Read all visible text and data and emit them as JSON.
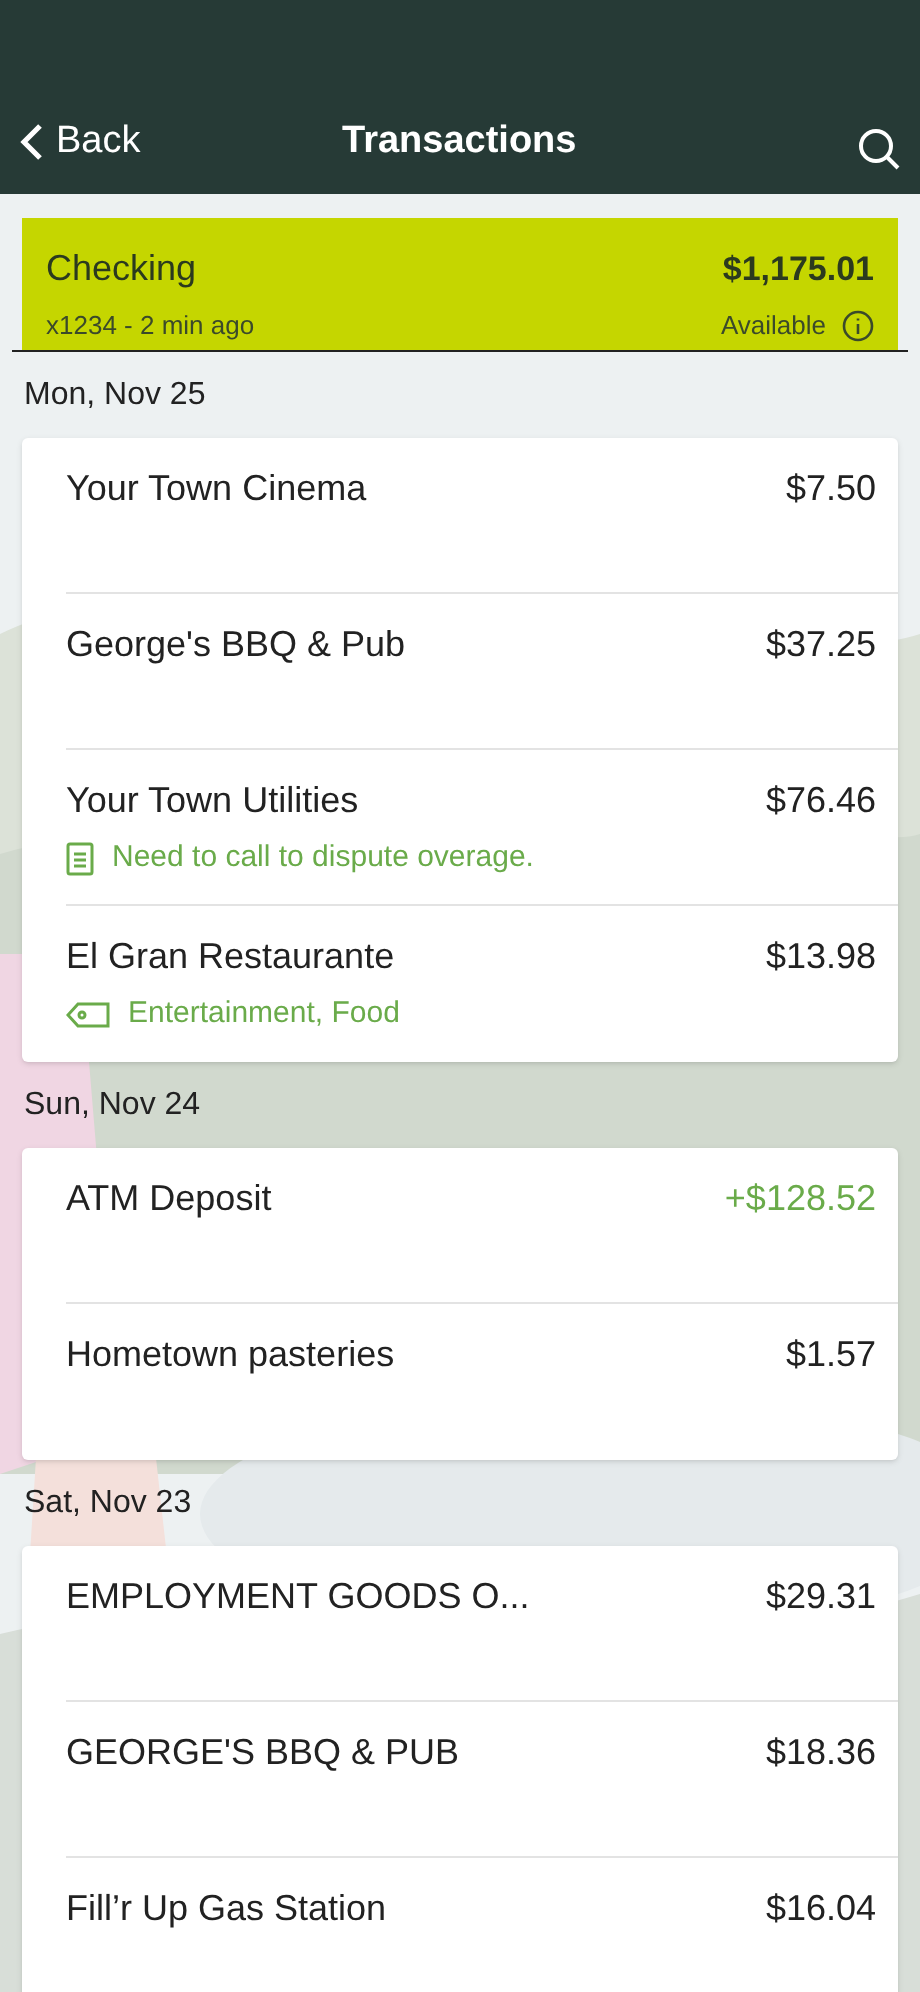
{
  "header": {
    "back": "Back",
    "title": "Transactions"
  },
  "account": {
    "name": "Checking",
    "balance": "$1,175.01",
    "detail": "x1234 - 2 min ago",
    "balance_label": "Available"
  },
  "days": [
    {
      "date": "Mon, Nov 25",
      "transactions": [
        {
          "name": "Your Town Cinema",
          "amount": "$7.50",
          "credit": false
        },
        {
          "name": "George's BBQ & Pub",
          "amount": "$37.25",
          "credit": false
        },
        {
          "name": "Your Town Utilities",
          "amount": "$76.46",
          "credit": false,
          "extra": {
            "kind": "note",
            "text": "Need to call to dispute overage."
          }
        },
        {
          "name": "El Gran Restaurante",
          "amount": "$13.98",
          "credit": false,
          "extra": {
            "kind": "tags",
            "text": "Entertainment, Food"
          }
        }
      ]
    },
    {
      "date": "Sun, Nov 24",
      "transactions": [
        {
          "name": "ATM Deposit",
          "amount": "+$128.52",
          "credit": true
        },
        {
          "name": "Hometown pasteries",
          "amount": "$1.57",
          "credit": false
        }
      ]
    },
    {
      "date": "Sat, Nov 23",
      "transactions": [
        {
          "name": "EMPLOYMENT GOODS O...",
          "amount": "$29.31",
          "credit": false
        },
        {
          "name": "GEORGE'S BBQ & PUB",
          "amount": "$18.36",
          "credit": false
        },
        {
          "name": "Fill’r Up Gas Station",
          "amount": "$16.04",
          "credit": false
        }
      ]
    }
  ]
}
